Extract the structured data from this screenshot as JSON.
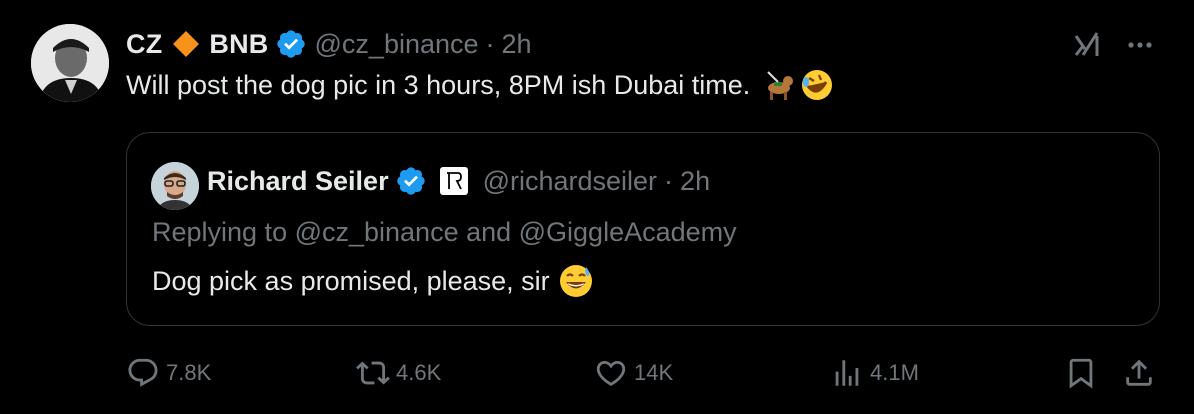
{
  "tweet": {
    "author": {
      "name_first": "CZ",
      "name_second": "BNB",
      "handle": "@cz_binance",
      "separator": "·",
      "time": "2h"
    },
    "text": "Will post the dog pic in 3 hours, 8PM ish Dubai time."
  },
  "quote": {
    "author": {
      "name": "Richard Seiler",
      "handle": "@richardseiler",
      "separator": "·",
      "time": "2h"
    },
    "replying_to": "Replying to @cz_binance and @GiggleAcademy",
    "text": "Dog pick as promised, please, sir"
  },
  "actions": {
    "reply_count": "7.8K",
    "repost_count": "4.6K",
    "like_count": "14K",
    "views_count": "4.1M"
  },
  "icons": {
    "diamond": "orange-diamond-icon",
    "verified": "verified-badge-icon",
    "grok": "grok-icon",
    "more": "more-options-icon",
    "reply": "reply-icon",
    "repost": "repost-icon",
    "like": "heart-icon",
    "views": "views-icon",
    "bookmark": "bookmark-icon",
    "share": "share-icon",
    "emoji_dog": "guide-dog-emoji-icon",
    "emoji_laugh": "rolling-laughing-emoji-icon",
    "emoji_sweat": "sweat-smile-emoji-icon"
  },
  "colors": {
    "background": "#000000",
    "primary_text": "#e7e9ea",
    "secondary_text": "#71767b",
    "verified_blue": "#1d9bf0",
    "border": "#2f3336",
    "diamond_orange": "#f7931a"
  }
}
